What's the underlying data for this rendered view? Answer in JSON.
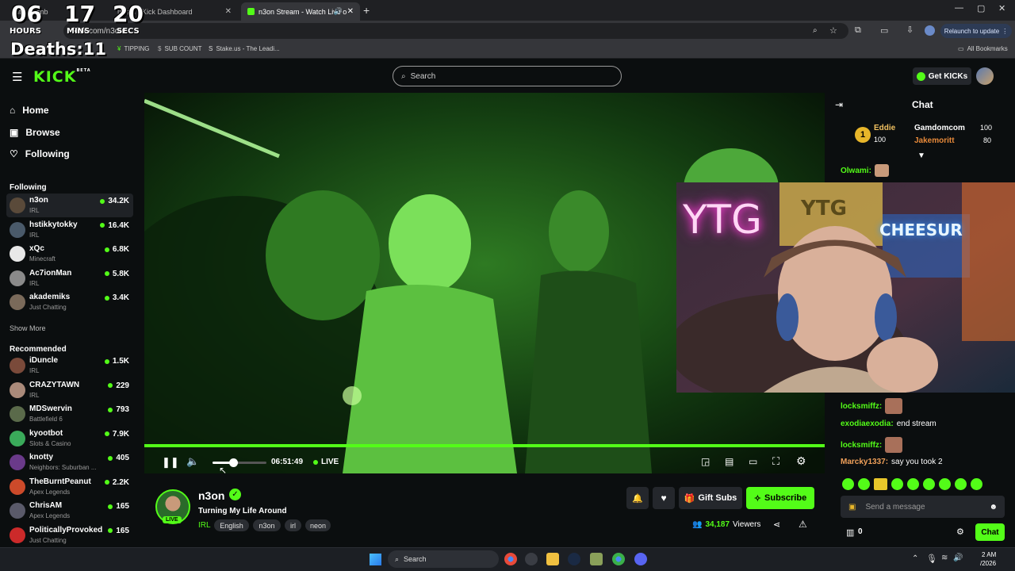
{
  "browser": {
    "tabs": [
      {
        "label": "it - Dashb"
      },
      {
        "label": "tream - Kick Dashboard"
      },
      {
        "label": "n3on Stream - Watch Live o"
      }
    ],
    "url": "kick.com/n3on",
    "relaunch_label": "Relaunch to update",
    "bookmarks": [
      {
        "label": "TIPPING"
      },
      {
        "label": "SUB COUNT"
      },
      {
        "label": "Stake.us - The Leadi..."
      }
    ],
    "all_bookmarks": "All Bookmarks"
  },
  "overlay": {
    "hours": "06",
    "hours_label": "HOURS",
    "mins": "17",
    "mins_label": "MINS",
    "secs": "20",
    "secs_label": "SECS",
    "deaths": "Deaths:11"
  },
  "header": {
    "logo": "KICK",
    "logo_badge": "BETA",
    "search_placeholder": "Search",
    "get_kicks": "Get KICKs"
  },
  "sidebar": {
    "nav": [
      {
        "label": "Home"
      },
      {
        "label": "Browse"
      },
      {
        "label": "Following"
      }
    ],
    "following_heading": "Following",
    "following": [
      {
        "name": "n3on",
        "category": "IRL",
        "viewers": "34.2K",
        "color": "#5a4a3a"
      },
      {
        "name": "hstikkytokky",
        "category": "IRL",
        "viewers": "16.4K",
        "color": "#4a5a6a"
      },
      {
        "name": "xQc",
        "category": "Minecraft",
        "viewers": "6.8K",
        "color": "#e8e8e8"
      },
      {
        "name": "Ac7ionMan",
        "category": "IRL",
        "viewers": "5.8K",
        "color": "#8a8a8a"
      },
      {
        "name": "akademiks",
        "category": "Just Chatting",
        "viewers": "3.4K",
        "color": "#7a6a5a"
      }
    ],
    "show_more": "Show More",
    "recommended_heading": "Recommended",
    "recommended": [
      {
        "name": "iDuncle",
        "category": "IRL",
        "viewers": "1.5K",
        "color": "#7a4a3a"
      },
      {
        "name": "CRAZYTAWN",
        "category": "IRL",
        "viewers": "229",
        "color": "#aa8a7a"
      },
      {
        "name": "MDSwervin",
        "category": "Battlefield 6",
        "viewers": "793",
        "color": "#5a6a4a"
      },
      {
        "name": "kyootbot",
        "category": "Slots & Casino",
        "viewers": "7.9K",
        "color": "#3aaa5a"
      },
      {
        "name": "knotty",
        "category": "Neighbors: Suburban ...",
        "viewers": "405",
        "color": "#6a3a8a"
      },
      {
        "name": "TheBurntPeanut",
        "category": "Apex Legends",
        "viewers": "2.2K",
        "color": "#cc4a2a"
      },
      {
        "name": "ChrisAM",
        "category": "Apex Legends",
        "viewers": "165",
        "color": "#5a5a6a"
      },
      {
        "name": "PoliticallyProvoked",
        "category": "Just Chatting",
        "viewers": "165",
        "color": "#cc2a2a"
      }
    ]
  },
  "player": {
    "timestamp": "06:51:49",
    "live": "LIVE",
    "volume": 0.38
  },
  "stream": {
    "channel": "n3on",
    "title": "Turning My Life Around",
    "category": "IRL",
    "live_badge": "LIVE",
    "tags": [
      "English",
      "n3on",
      "irl",
      "neon"
    ],
    "viewers": "34,187",
    "viewers_label": "Viewers",
    "gift_subs": "Gift Subs",
    "subscribe": "Subscribe"
  },
  "chat": {
    "title": "Chat",
    "leaders": [
      {
        "rank": "1",
        "name": "Eddie",
        "amount": "100"
      },
      {
        "name": "Gamdomcom",
        "amount": "100"
      },
      {
        "name": "Jakemoritt",
        "amount": "80"
      }
    ],
    "messages": [
      {
        "user": "Olwami:",
        "text": "",
        "color": "#53fc18"
      },
      {
        "user": "locksmiffz:",
        "text": "",
        "color": "#53fc18"
      },
      {
        "user": "exodiaexodia:",
        "text": "end stream",
        "color": "#53fc18"
      },
      {
        "user": "locksmiffz:",
        "text": "",
        "color": "#53fc18"
      },
      {
        "user": "Marcky1337:",
        "text": "say you took 2",
        "color": "#f0a05a"
      }
    ],
    "input_placeholder": "Send a message",
    "kicks_count": "0",
    "send_label": "Chat"
  },
  "pip": {
    "sign1": "YTG",
    "sign2": "YTG",
    "sign3": "CHEESUR"
  },
  "taskbar": {
    "search_label": "Search",
    "time": "2 AM",
    "date": "/2026"
  }
}
